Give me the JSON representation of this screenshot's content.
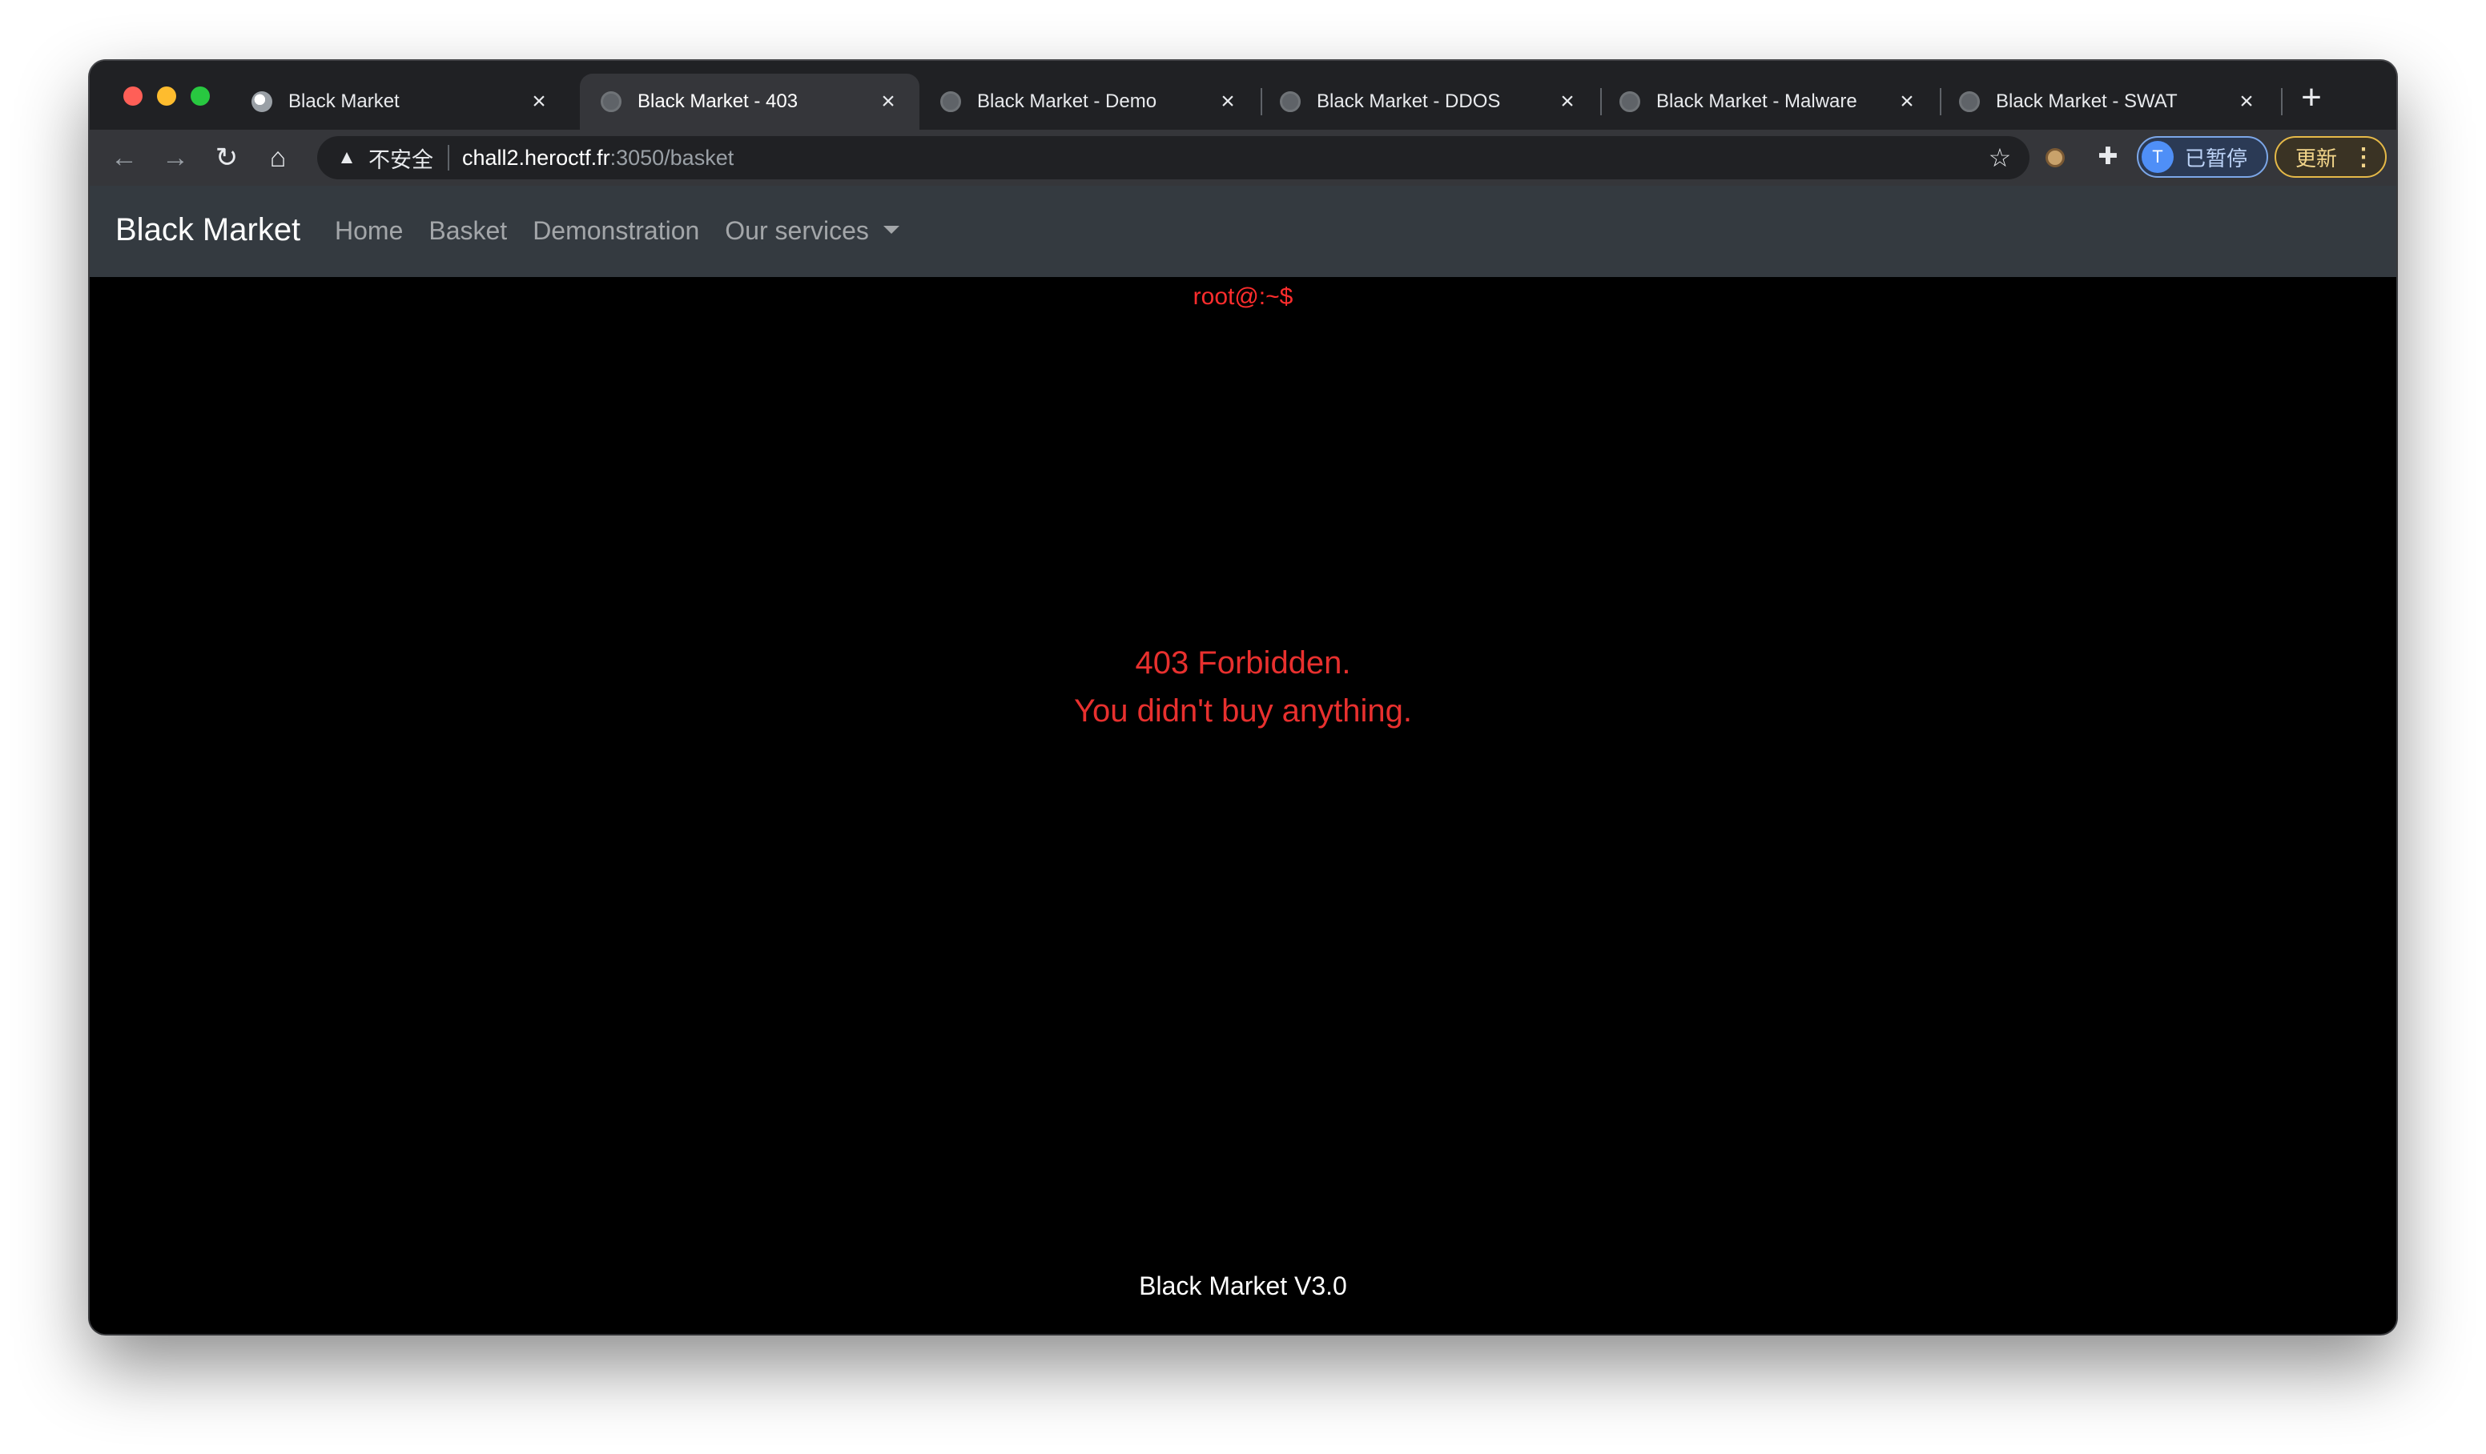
{
  "browser": {
    "tabs": [
      {
        "title": "Black Market",
        "active": false
      },
      {
        "title": "Black Market - 403",
        "active": true
      },
      {
        "title": "Black Market - Demo",
        "active": false
      },
      {
        "title": "Black Market - DDOS",
        "active": false
      },
      {
        "title": "Black Market - Malware",
        "active": false
      },
      {
        "title": "Black Market - SWAT",
        "active": false
      }
    ],
    "close_glyph": "×",
    "new_tab_glyph": "+",
    "security_label": "不安全",
    "url_host": "chall2.heroctf.fr",
    "url_path": ":3050/basket",
    "profile_initial": "T",
    "profile_label": "已暂停",
    "update_label": "更新",
    "icons": [
      "back-arrow-icon",
      "forward-arrow-icon",
      "reload-icon",
      "home-icon",
      "warning-icon",
      "star-icon",
      "cookie-extension-icon",
      "puzzle-extensions-icon",
      "kebab-menu-icon"
    ]
  },
  "site": {
    "brand": "Black Market",
    "nav": [
      "Home",
      "Basket",
      "Demonstration",
      "Our services"
    ],
    "prompt": "root@:~$",
    "error_line1": "403 Forbidden.",
    "error_line2": "You didn't buy anything.",
    "footer": "Black Market V3.0"
  },
  "colors": {
    "error_red": "#e8302e",
    "navbar_bg": "#343a40",
    "page_bg": "#000000"
  }
}
